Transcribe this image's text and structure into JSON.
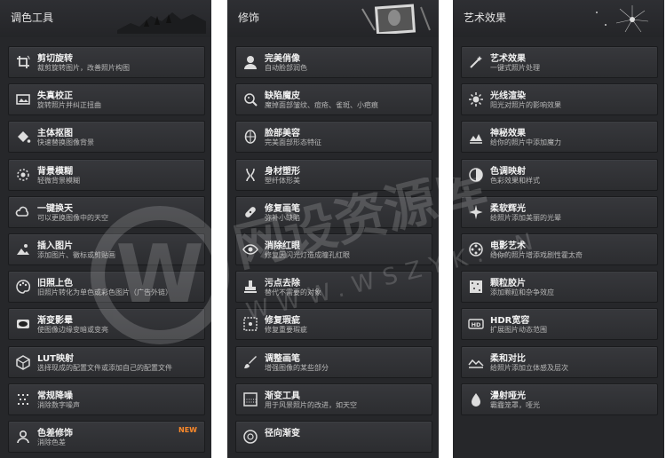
{
  "panels": [
    {
      "title": "调色工具",
      "items": [
        {
          "title": "剪切旋转",
          "subtitle": "裁剪旋转图片，改善照片构图",
          "icon": "crop-rotate-icon"
        },
        {
          "title": "失真校正",
          "subtitle": "旋转照片并纠正扭曲",
          "icon": "distortion-correction-icon"
        },
        {
          "title": "主体抠图",
          "subtitle": "快速替换图像背景",
          "icon": "paint-bucket-icon"
        },
        {
          "title": "背景模糊",
          "subtitle": "轻微背景模糊",
          "icon": "background-blur-icon"
        },
        {
          "title": "一键换天",
          "subtitle": "可以更换图像中的天空",
          "icon": "cloud-icon"
        },
        {
          "title": "插入图片",
          "subtitle": "添加图片、徽标或剪贴画",
          "icon": "insert-image-icon"
        },
        {
          "title": "旧照上色",
          "subtitle": "旧照片转化为单色或彩色图片（广告外链）",
          "icon": "palette-icon"
        },
        {
          "title": "渐变影晕",
          "subtitle": "使图像边缘变暗或变亮",
          "icon": "vignette-icon"
        },
        {
          "title": "LUT映射",
          "subtitle": "选择现成的配置文件或添加自己的配置文件",
          "icon": "lut-cube-icon"
        },
        {
          "title": "常规降噪",
          "subtitle": "消除数字噪声",
          "icon": "denoise-icon"
        },
        {
          "title": "色差修饰",
          "subtitle": "消除色差",
          "icon": "person-icon",
          "badge": "NEW"
        }
      ]
    },
    {
      "title": "修饰",
      "items": [
        {
          "title": "完美俏像",
          "subtitle": "自动脸部润色",
          "icon": "portrait-icon"
        },
        {
          "title": "缺陷魔皮",
          "subtitle": "魔掉面部皱纹、痘疮、雀斑、小疤痕",
          "icon": "skin-wand-icon"
        },
        {
          "title": "脸部美容",
          "subtitle": "完美面部形态特征",
          "icon": "face-icon"
        },
        {
          "title": "身材塑形",
          "subtitle": "塑纤体形美",
          "icon": "body-icon"
        },
        {
          "title": "修复画笔",
          "subtitle": "弥补小缺陷",
          "icon": "bandage-icon"
        },
        {
          "title": "消除红眼",
          "subtitle": "修复因闪光灯造成瞳孔红眼",
          "icon": "eye-icon"
        },
        {
          "title": "污点去除",
          "subtitle": "替代不需要的对象",
          "icon": "stamp-icon"
        },
        {
          "title": "修复瑕疵",
          "subtitle": "修复重要瑕疵",
          "icon": "grain-square-icon"
        },
        {
          "title": "调整画笔",
          "subtitle": "增强图像的某些部分",
          "icon": "brush-icon"
        },
        {
          "title": "渐变工具",
          "subtitle": "用于风景照片的改进，如天空",
          "icon": "gradient-icon"
        },
        {
          "title": "径向渐变",
          "subtitle": "",
          "icon": "radial-icon"
        }
      ]
    },
    {
      "title": "艺术效果",
      "items": [
        {
          "title": "艺术效果",
          "subtitle": "一键式照片处理",
          "icon": "magic-wand-icon"
        },
        {
          "title": "光线渲染",
          "subtitle": "阳光对照片的影响效果",
          "icon": "sun-icon"
        },
        {
          "title": "神秘效果",
          "subtitle": "给你的照片中添加魔力",
          "icon": "mystic-icon"
        },
        {
          "title": "色调映射",
          "subtitle": "色彩效果和样式",
          "icon": "tone-mapping-icon"
        },
        {
          "title": "柔软辉光",
          "subtitle": "给照片添加美丽的光晕",
          "icon": "sparkle-icon"
        },
        {
          "title": "电影艺术",
          "subtitle": "给你的照片增添戏剧性霍太奇",
          "icon": "film-reel-icon"
        },
        {
          "title": "颗粒胶片",
          "subtitle": "添加颗粒和杂争效应",
          "icon": "grain-icon"
        },
        {
          "title": "HDR宽容",
          "subtitle": "扩展图片动态范围",
          "icon": "hdr-icon"
        },
        {
          "title": "柔和对比",
          "subtitle": "给照片添加立体感及层次",
          "icon": "soft-contrast-icon"
        },
        {
          "title": "漫射哑光",
          "subtitle": "霸霾笼罩，哑光",
          "icon": "diffuse-icon"
        }
      ]
    }
  ],
  "watermark": {
    "logo_text": "W",
    "text": "网设资源库",
    "url": "WWW.WSZYK.CN"
  },
  "colors": {
    "panel_bg": "#26272a",
    "item_bg": "#34353a",
    "title": "#f2f2f2",
    "subtitle": "#b8b8b8",
    "badge": "#ff8a2a"
  }
}
